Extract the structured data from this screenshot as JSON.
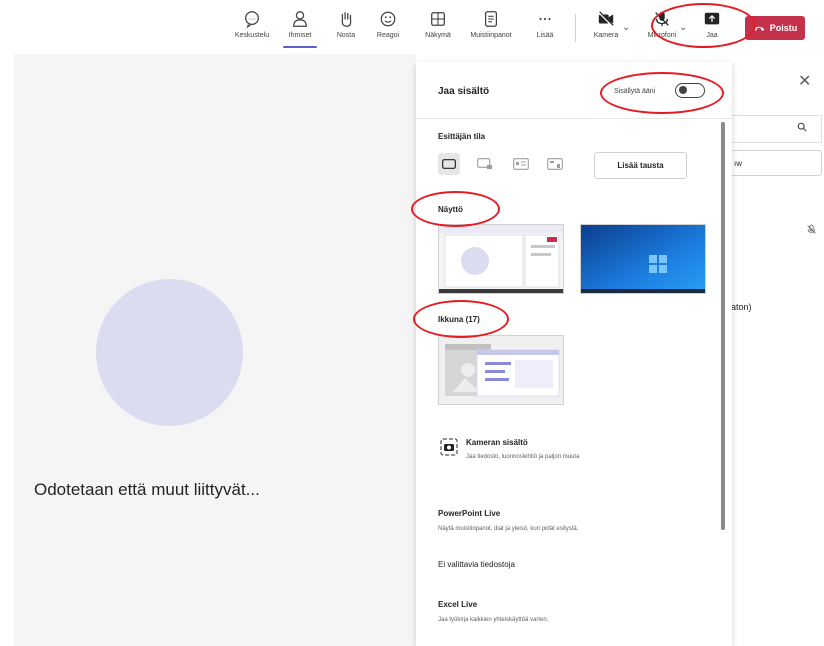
{
  "toolbar": {
    "items": [
      {
        "label": "Keskustelu",
        "icon": "chat-icon"
      },
      {
        "label": "Ihmiset",
        "icon": "people-icon"
      },
      {
        "label": "Nosta",
        "icon": "raise-hand-icon"
      },
      {
        "label": "Reagoi",
        "icon": "smile-icon"
      },
      {
        "label": "Näkymä",
        "icon": "grid-icon"
      },
      {
        "label": "Muistiinpanot",
        "icon": "notes-icon"
      },
      {
        "label": "Lisää",
        "icon": "more-icon"
      },
      {
        "label": "Kamera",
        "icon": "camera-off-icon"
      },
      {
        "label": "Mikrofoni",
        "icon": "mic-off-icon"
      },
      {
        "label": "Jaa",
        "icon": "share-icon"
      }
    ],
    "leave_label": "Poistu",
    "leave_color": "#c4314b",
    "active_color": "#5b5fc7"
  },
  "stage": {
    "waiting_text": "Odotetaan että muut liittyvät..."
  },
  "people_panel": {
    "button_partial": "ıw",
    "participant_partial": "aton)"
  },
  "share_panel": {
    "title": "Jaa sisältö",
    "include_sound_label": "Sisällytä ääni",
    "include_sound_on": false,
    "presenter_mode_label": "Esittäjän tila",
    "add_background_label": "Lisää tausta",
    "screen_label": "Näyttö",
    "window_label": "Ikkuna (17)",
    "options": [
      {
        "title": "Kameran sisältö",
        "subtitle": "Jaa tiedosto, luonnoslehtiö ja paljon muuta",
        "icon": "camera-content-icon"
      },
      {
        "title": "PowerPoint Live",
        "subtitle": "Näytä muistiinpanot, diat ja yleisö, kun pidät esitystä."
      },
      {
        "title": "Ei valittavia tiedostoja",
        "subtitle": ""
      },
      {
        "title": "Excel Live",
        "subtitle": "Jaa työkirja kaikkien yhteiskäyttöä varten."
      }
    ]
  },
  "highlight_color": "#e51c23"
}
